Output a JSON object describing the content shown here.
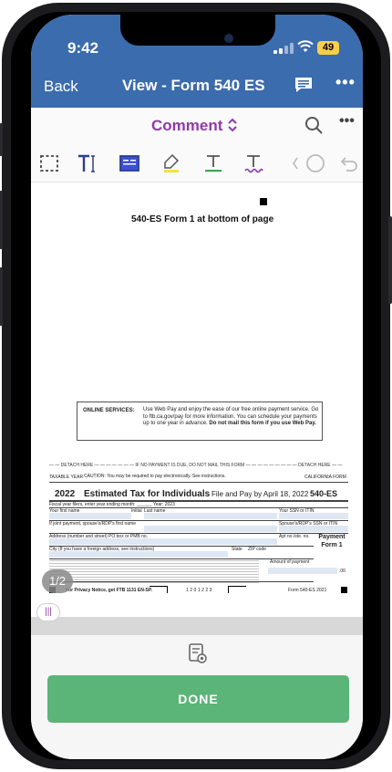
{
  "status": {
    "time": "9:42",
    "battery": "49"
  },
  "nav": {
    "back": "Back",
    "title": "View - Form 540 ES"
  },
  "comment_bar": {
    "label": "Comment"
  },
  "document": {
    "heading": "540-ES Form 1 at bottom of page",
    "online_services": {
      "label": "ONLINE SERVICES:",
      "text": "Use Web Pay and enjoy the ease of our free online payment service. Go to ftb.ca.gov/pay for more information. You can schedule your payments up to one year in advance.",
      "bold": "Do not mail this form if you use Web Pay."
    },
    "detach_line": "— — DETACH HERE — — — — — — — IF NO PAYMENT IS DUE, DO NOT MAIL THIS FORM — — — — — — — — — DETACH HERE — —",
    "form": {
      "taxable_year": "TAXABLE YEAR",
      "caution": "CAUTION: You may be required to pay electronically. See instructions.",
      "california_form": "CALIFORNIA FORM",
      "year": "2022",
      "title": "Estimated Tax for Individuals",
      "pay_by": "File and Pay by April 18, 2022",
      "code": "540-ES",
      "fiscal": "Fiscal year filers, enter year ending month: ______ Year: 2023",
      "first_name": "Your first name",
      "initial": "Initial",
      "last_name": "Last name",
      "ssn": "Your SSN or ITIN",
      "spouse_name": "If joint payment, spouse's/RDP's first name",
      "spouse_ssn": "Spouse's/RDP's SSN or ITIN",
      "address": "Address (number and street) PO box or PMB no.",
      "apt": "Apt no./ste. no.",
      "city": "City (If you have a foreign address, see instructions)",
      "state": "State",
      "zip": "ZIP code",
      "payment_form": "Payment Form 1",
      "amount": "Amount of payment",
      "cents": ".00",
      "privacy": "For Privacy Notice, get FTB 1131 EN-SP.",
      "barcode_num": "1201223",
      "footer_code": "Form 540-ES 2021"
    },
    "page_indicator": "1/2"
  },
  "footer": {
    "done": "DONE"
  },
  "icons": [
    "back-chevron",
    "comment-bubble-icon",
    "more-icon",
    "chevron-updown-icon",
    "search-icon",
    "select-rect-icon",
    "text-tool-icon",
    "text-box-icon",
    "highlighter-icon",
    "underline-icon",
    "squiggle-icon",
    "shape-icon",
    "undo-icon",
    "read-mode-icon"
  ],
  "colors": {
    "nav": "#3b6cad",
    "accent": "#8e3aa6",
    "done": "#5bb478"
  }
}
